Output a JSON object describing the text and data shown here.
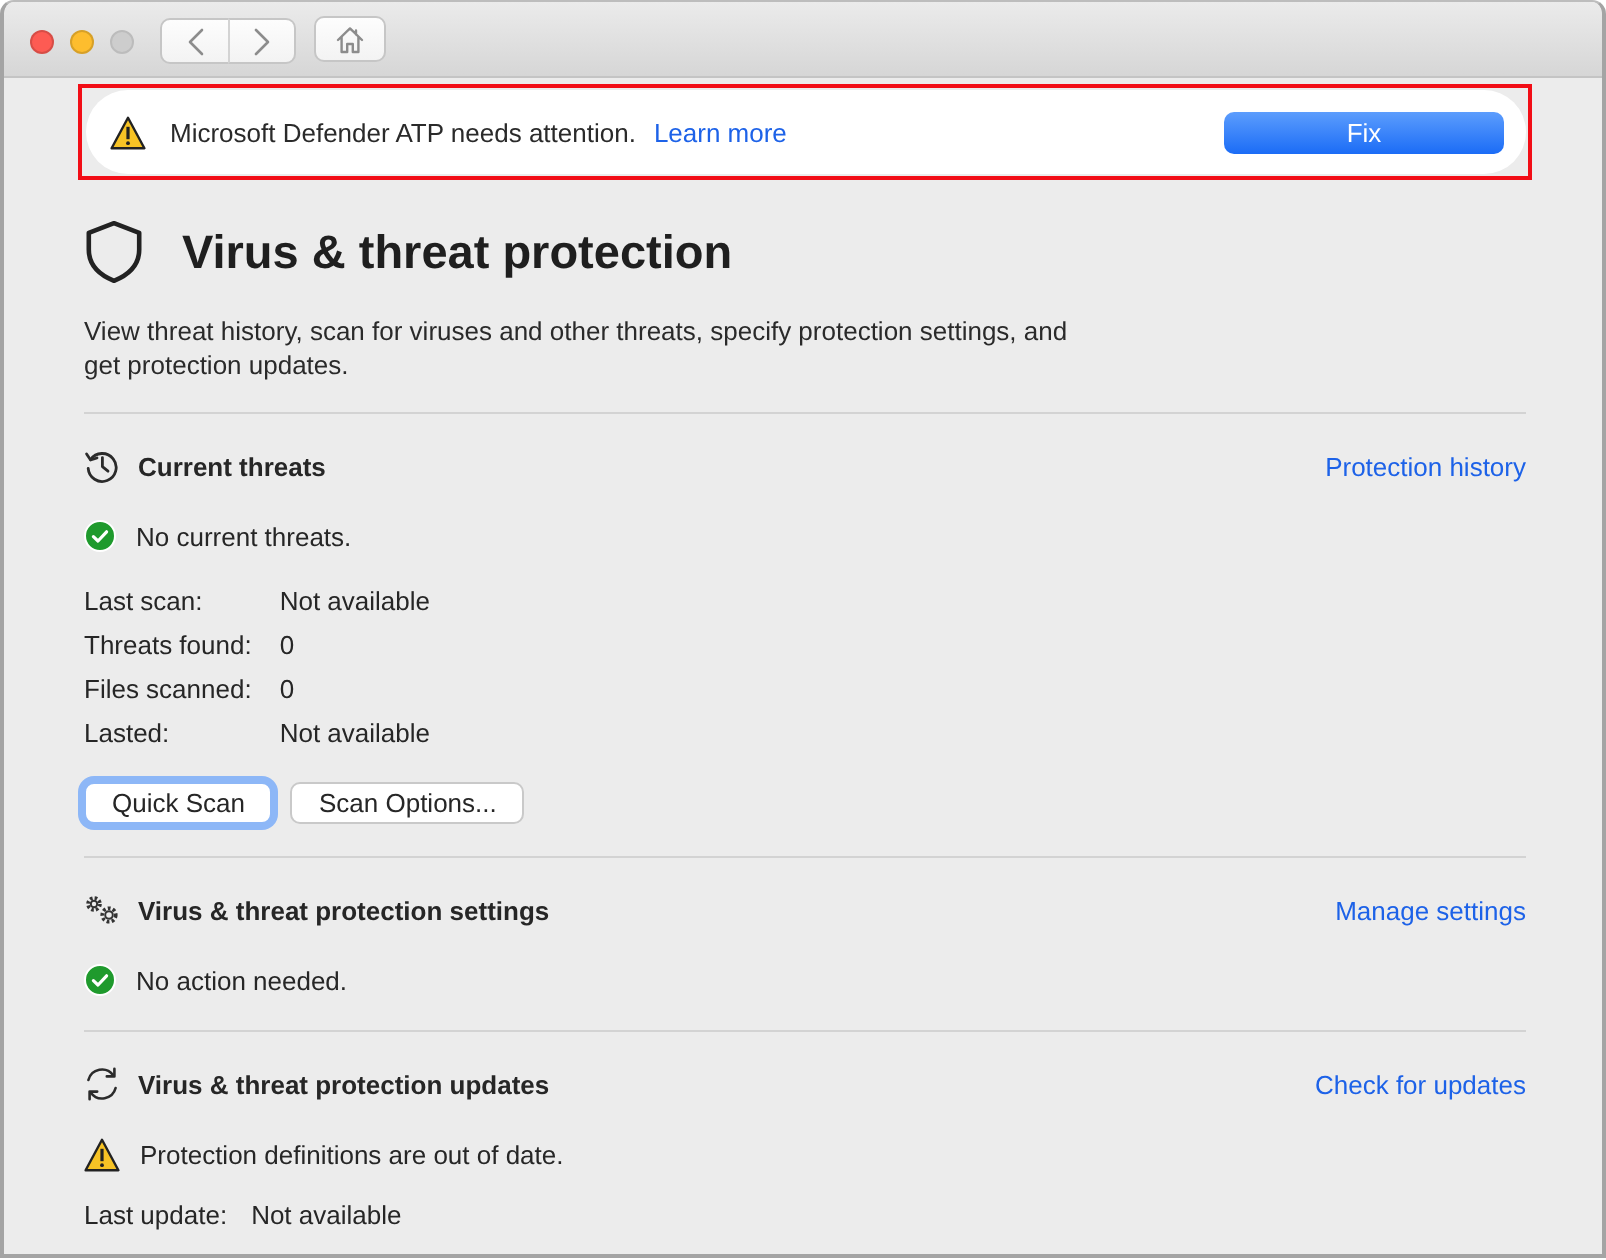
{
  "window_controls": [
    {
      "kind": "close",
      "enabled": true
    },
    {
      "kind": "minimize",
      "enabled": true
    },
    {
      "kind": "zoom",
      "enabled": false
    }
  ],
  "banner": {
    "highlighted": true,
    "message": "Microsoft Defender ATP needs attention.",
    "link": "Learn more",
    "button": "Fix"
  },
  "header": {
    "title": "Virus & threat protection",
    "description": "View threat history, scan for viruses and other threats, specify protection settings, and get protection updates."
  },
  "sections": [
    {
      "kind": "threats",
      "title": "Current threats",
      "link": "Protection history",
      "status": {
        "kind": "ok",
        "text": "No current threats."
      },
      "details": [
        {
          "label": "Last scan:",
          "value": "Not available"
        },
        {
          "label": "Threats found:",
          "value": "0"
        },
        {
          "label": "Files scanned:",
          "value": "0"
        },
        {
          "label": "Lasted:",
          "value": "Not available"
        }
      ],
      "buttons": [
        {
          "label": "Quick Scan",
          "focused": true
        },
        {
          "label": "Scan Options...",
          "focused": false
        }
      ]
    },
    {
      "kind": "settings",
      "title": "Virus & threat protection settings",
      "link": "Manage settings",
      "status": {
        "kind": "ok",
        "text": "No action needed."
      }
    },
    {
      "kind": "updates",
      "title": "Virus & threat protection updates",
      "link": "Check for updates",
      "status": {
        "kind": "warning",
        "text": "Protection definitions are out of date."
      },
      "details": [
        {
          "label": "Last update:",
          "value": "Not available"
        }
      ]
    }
  ]
}
